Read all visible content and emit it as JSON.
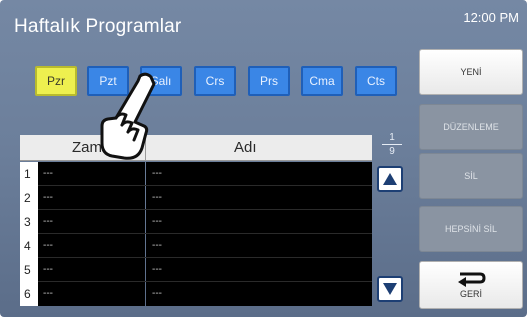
{
  "header": {
    "title": "Haftalık Programlar",
    "clock": "12:00 PM"
  },
  "days": [
    {
      "label": "Pzr",
      "active": true
    },
    {
      "label": "Pzt",
      "active": false
    },
    {
      "label": "Salı",
      "active": false
    },
    {
      "label": "Crs",
      "active": false
    },
    {
      "label": "Prs",
      "active": false
    },
    {
      "label": "Cma",
      "active": false
    },
    {
      "label": "Cts",
      "active": false
    }
  ],
  "table": {
    "headers": {
      "time": "Zaman",
      "name": "Adı"
    },
    "rows": [
      {
        "num": "1",
        "time": "---",
        "name": "---"
      },
      {
        "num": "2",
        "time": "---",
        "name": "---"
      },
      {
        "num": "3",
        "time": "---",
        "name": "---"
      },
      {
        "num": "4",
        "time": "---",
        "name": "---"
      },
      {
        "num": "5",
        "time": "---",
        "name": "---"
      },
      {
        "num": "6",
        "time": "---",
        "name": "---"
      }
    ]
  },
  "pagination": {
    "current": "1",
    "total": "9"
  },
  "actions": {
    "new": "YENİ",
    "edit": "DÜZENLEME",
    "delete": "SİL",
    "delete_all": "HEPSİNİ SİL",
    "back": "GERİ"
  },
  "icons": {
    "scroll_up": "triangle-up-icon",
    "scroll_down": "triangle-down-icon",
    "back": "return-arrow-icon",
    "pointer": "hand-pointer-icon"
  },
  "colors": {
    "day_tab": "#3a86e6",
    "day_tab_active": "#eef04f",
    "background": "#6c7f9b"
  }
}
